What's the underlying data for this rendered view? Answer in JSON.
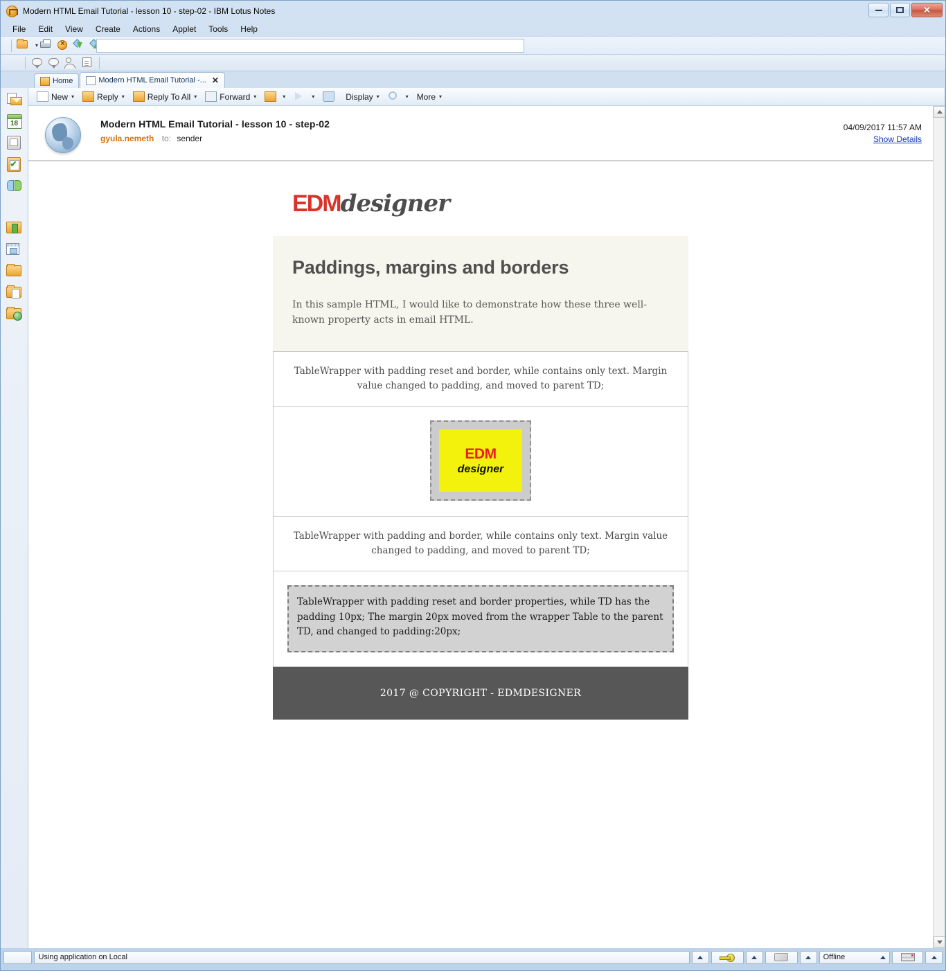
{
  "window": {
    "title": "Modern HTML Email Tutorial - lesson 10 - step-02 - IBM Lotus Notes",
    "app_icon": "lotus-notes-icon",
    "minimize_label": "Minimize",
    "maximize_label": "Maximize",
    "close_label": "Close"
  },
  "menubar": {
    "items": [
      {
        "label": "File"
      },
      {
        "label": "Edit"
      },
      {
        "label": "View"
      },
      {
        "label": "Create"
      },
      {
        "label": "Actions"
      },
      {
        "label": "Applet"
      },
      {
        "label": "Tools"
      },
      {
        "label": "Help"
      }
    ]
  },
  "toolbar_primary": {
    "icons": [
      {
        "name": "open-folder-icon"
      },
      {
        "name": "print-icon"
      },
      {
        "name": "cancel-icon"
      },
      {
        "name": "download-icon"
      },
      {
        "name": "upload-icon"
      },
      {
        "name": "open-document-icon"
      },
      {
        "name": "sync-icon"
      },
      {
        "name": "link-icon"
      },
      {
        "name": "find-icon"
      },
      {
        "name": "search-icon"
      },
      {
        "name": "edit-icon"
      },
      {
        "name": "help-icon"
      }
    ]
  },
  "toolbar_secondary": {
    "icons": [
      {
        "name": "chat-icon"
      },
      {
        "name": "chat-group-icon"
      },
      {
        "name": "add-contact-icon"
      },
      {
        "name": "addressbook-icon"
      }
    ]
  },
  "tabs": [
    {
      "label": "Home",
      "icon": "home-icon",
      "active": false,
      "closable": false
    },
    {
      "label": "Modern HTML Email Tutorial -...",
      "icon": "mail-doc-icon",
      "active": true,
      "closable": true,
      "close_label": "✕"
    }
  ],
  "sidebar": {
    "items": [
      {
        "name": "sidebar-item-mail",
        "icon": "mail-icon"
      },
      {
        "name": "sidebar-item-calendar",
        "icon": "calendar-icon",
        "badge": "18"
      },
      {
        "name": "sidebar-item-contacts",
        "icon": "contacts-icon"
      },
      {
        "name": "sidebar-item-todo",
        "icon": "todo-icon",
        "glyph": "✔"
      },
      {
        "name": "sidebar-item-replication",
        "icon": "replication-icon"
      },
      {
        "name": "sidebar-item-bookmarks",
        "icon": "bookmark-folder-icon"
      },
      {
        "name": "sidebar-item-workspace",
        "icon": "workspace-icon"
      },
      {
        "name": "sidebar-item-folder",
        "icon": "folder-icon"
      },
      {
        "name": "sidebar-item-archive",
        "icon": "folder-document-icon"
      },
      {
        "name": "sidebar-item-web",
        "icon": "folder-globe-icon"
      }
    ]
  },
  "actionbar": {
    "buttons": [
      {
        "label": "New",
        "icon": "new-icon",
        "has_caret": true
      },
      {
        "label": "Reply",
        "icon": "reply-icon",
        "has_caret": true
      },
      {
        "label": "Reply To All",
        "icon": "reply-all-icon",
        "has_caret": true
      },
      {
        "label": "Forward",
        "icon": "forward-icon",
        "has_caret": true
      },
      {
        "label": "",
        "icon": "folder-icon",
        "has_caret": true
      },
      {
        "label": "",
        "icon": "flag-icon",
        "has_caret": true
      },
      {
        "label": "",
        "icon": "trash-icon",
        "has_caret": false
      },
      {
        "label": "Display",
        "icon": "",
        "has_caret": true
      },
      {
        "label": "",
        "icon": "search-icon",
        "has_caret": true
      },
      {
        "label": "More",
        "icon": "",
        "has_caret": true
      }
    ],
    "caret_glyph": "▾"
  },
  "message": {
    "avatar": "globe-icon",
    "subject": "Modern HTML Email Tutorial - lesson 10 - step-02",
    "from": "gyula.nemeth",
    "to_label": "to:",
    "to": "sender",
    "date": "04/09/2017 11:57 AM",
    "details_link": "Show Details"
  },
  "email": {
    "logo": {
      "part1": "EDM",
      "part2": "designer",
      "color1": "#d8342a",
      "color2": "#4d4d4d"
    },
    "heading": "Paddings, margins and borders",
    "intro": "In this sample HTML, I would like to demonstrate how these three well-known property acts in email HTML.",
    "block1_text": "TableWrapper with padding reset and border, while contains only text. Margin value changed to padding, and moved to parent TD;",
    "image_block": {
      "alt_line1": "EDM",
      "alt_line2": "designer",
      "bg_color": "#f2f20c",
      "pad_color": "#cccccc",
      "border_style": "dashed"
    },
    "block2_text": "TableWrapper with padding and border, while contains only text. Margin value changed to padding, and moved to parent TD;",
    "block3_text": "TableWrapper with padding reset and border properties, while TD has the padding 10px; The margin 20px moved from the wrapper Table to the parent TD, and changed to padding:20px;",
    "footer": "2017 @ COPYRIGHT - EDMDESIGNER",
    "intro_bg": "#f7f6ee",
    "footer_bg": "#575757"
  },
  "scrollbar": {
    "up_label": "Scroll up",
    "down_label": "Scroll down"
  },
  "statusbar": {
    "message": "Using application on Local",
    "offline_label": "Offline",
    "key_icon": "key-icon",
    "pen_icon": "pen-icon",
    "tray_icon": "tray-icon",
    "arrow_glyph": "▲"
  }
}
